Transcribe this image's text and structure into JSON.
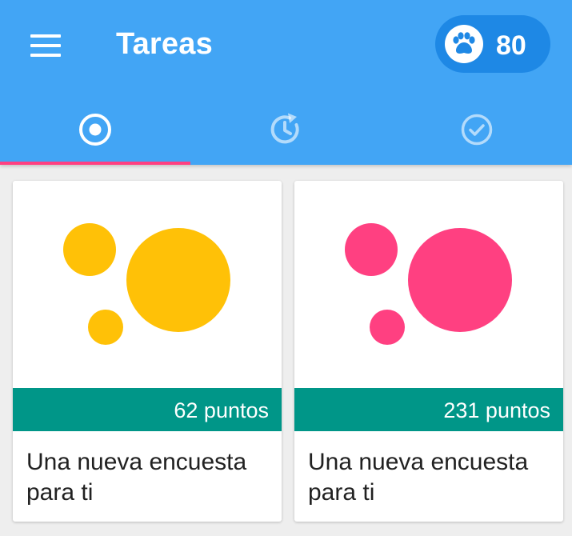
{
  "header": {
    "title": "Tareas",
    "points": "80",
    "icons": {
      "menu": "menu-icon",
      "points": "paw-icon"
    }
  },
  "tabs": [
    {
      "icon": "radio-target-icon",
      "selected": true
    },
    {
      "icon": "clock-refresh-icon",
      "selected": false
    },
    {
      "icon": "check-circle-icon",
      "selected": false
    }
  ],
  "colors": {
    "appbar": "#42a5f5",
    "pill": "#1e88e5",
    "indicator": "#ff4081",
    "points_bar": "#009688"
  },
  "cards": [
    {
      "points_label": "62 puntos",
      "title": "Una nueva encuesta para ti",
      "accent": "#ffc107"
    },
    {
      "points_label": "231 puntos",
      "title": "Una nueva encuesta para ti",
      "accent": "#ff4081"
    }
  ]
}
